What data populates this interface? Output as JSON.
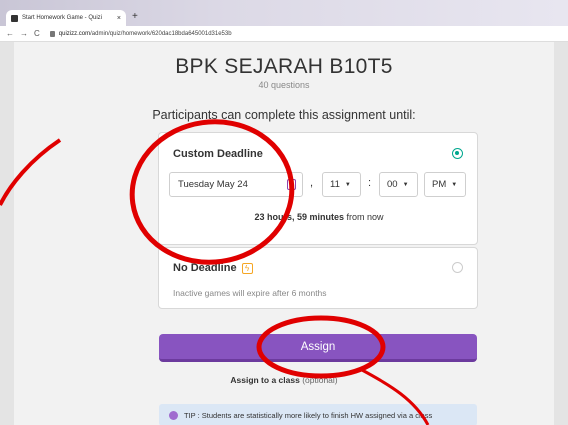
{
  "browser": {
    "tab_title": "Start Homework Game - Quizi",
    "tab_close": "×",
    "new_tab": "+",
    "nav_back": "←",
    "nav_forward": "→",
    "nav_reload": "C",
    "url_domain": "quizizz.com",
    "url_path": "/admin/quiz/homework/620dac18bda645001d31e53b"
  },
  "header": {
    "title": "BPK SEJARAH B10T5",
    "subtitle": "40 questions"
  },
  "prompt": "Participants can complete this assignment until:",
  "custom_deadline": {
    "label": "Custom Deadline",
    "date": "Tuesday May 24",
    "hour": "11",
    "minute": "00",
    "ampm": "PM",
    "comma": ",",
    "colon": ":",
    "remain_bold": "23 hours, 59 minutes",
    "remain_rest": "from now"
  },
  "no_deadline": {
    "label": "No Deadline",
    "note": "Inactive games will expire after 6 months"
  },
  "assign_button": "Assign",
  "assign_class": {
    "main": "Assign to a class",
    "optional": "(optional)"
  },
  "tip": "TIP : Students are statistically more likely to finish HW assigned via a class",
  "colors": {
    "accent": "#8854c0",
    "radio": "#00a78e",
    "annotation": "#e00000"
  }
}
